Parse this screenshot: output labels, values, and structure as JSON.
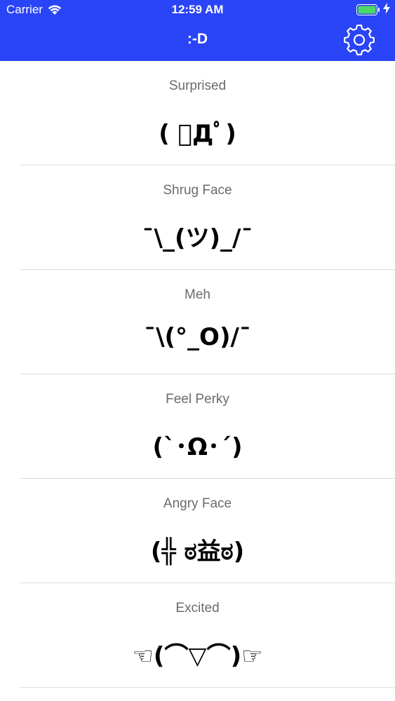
{
  "status_bar": {
    "carrier": "Carrier",
    "time": "12:59 AM"
  },
  "nav": {
    "title": ":-D",
    "settings_icon": "gear-icon"
  },
  "colors": {
    "accent": "#2a44f7",
    "battery": "#4cd964"
  },
  "faces": [
    {
      "name": "Surprised",
      "face": "( ﾟДﾟ)"
    },
    {
      "name": "Shrug Face",
      "face": "¯\\_(ツ)_/¯"
    },
    {
      "name": "Meh",
      "face": "¯\\(°_O)/¯"
    },
    {
      "name": "Feel Perky",
      "face": "(`･Ω･´)"
    },
    {
      "name": "Angry Face",
      "face": "(╬ ಠ益ಠ)"
    },
    {
      "name": "Excited",
      "face": "☜(⌒▽⌒)☞"
    }
  ]
}
